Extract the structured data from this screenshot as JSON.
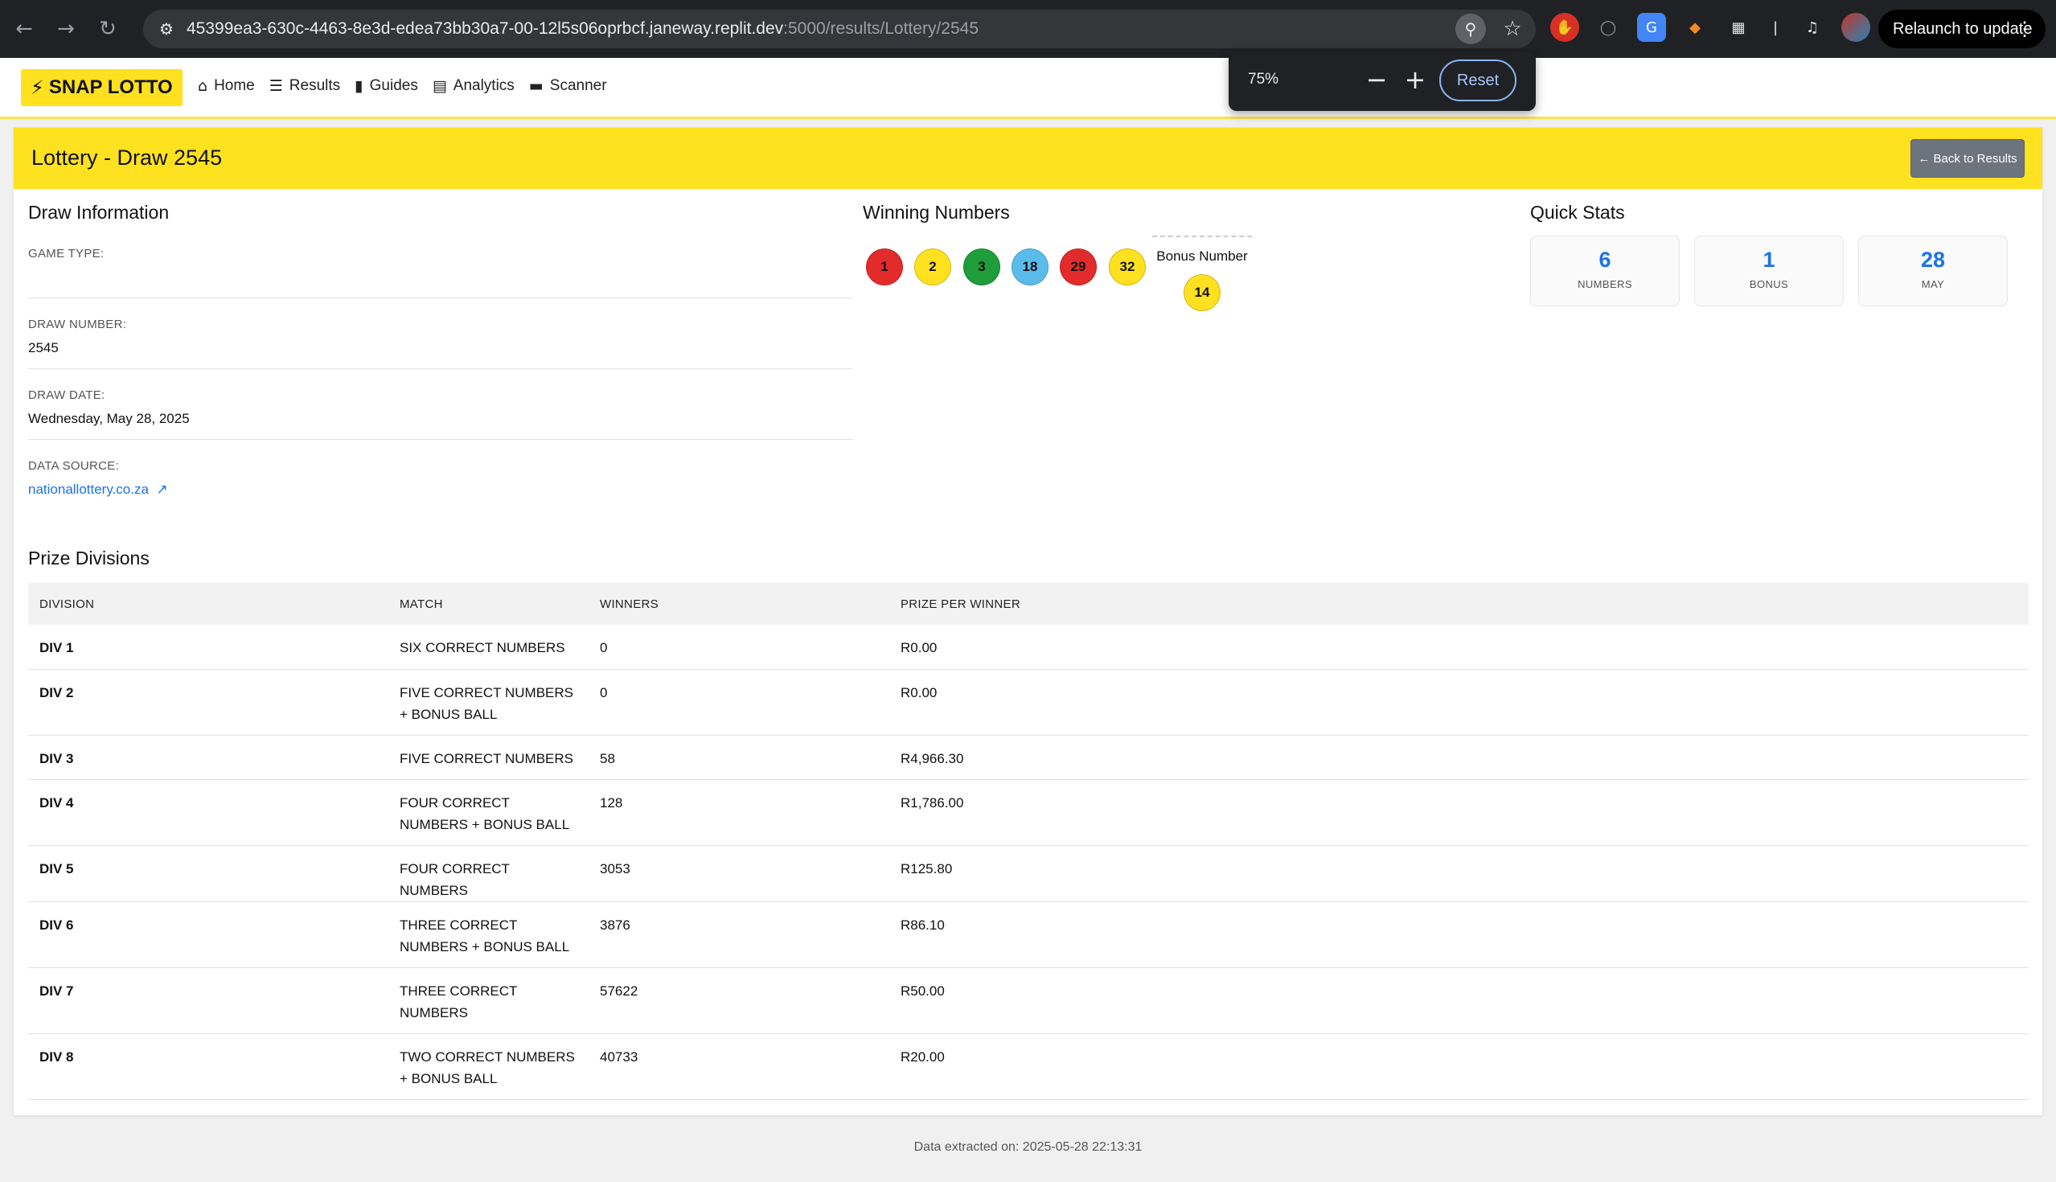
{
  "browser": {
    "url_host": "45399ea3-630c-4463-8e3d-edea73bb30a7-00-12l5s06oprbcf.janeway.replit.dev",
    "url_path": ":5000/results/Lottery/2545",
    "relaunch_label": "Relaunch to update",
    "zoom": {
      "value": "75%",
      "reset_label": "Reset"
    },
    "icons": [
      "back-arrow-icon",
      "forward-arrow-icon",
      "reload-icon",
      "site-settings-icon",
      "zoom-icon",
      "bookmark-star-icon",
      "extension-icon",
      "more-vert-icon"
    ]
  },
  "nav": {
    "brand": "SNAP LOTTO",
    "links": [
      {
        "label": "Home",
        "icon": "home-icon"
      },
      {
        "label": "Results",
        "icon": "list-icon"
      },
      {
        "label": "Guides",
        "icon": "book-icon"
      },
      {
        "label": "Analytics",
        "icon": "chart-icon"
      },
      {
        "label": "Scanner",
        "icon": "ticket-icon"
      }
    ]
  },
  "header": {
    "title": "Lottery - Draw 2545",
    "back_label": "Back to Results"
  },
  "draw_info": {
    "title": "Draw Information",
    "game_type_label": "GAME TYPE:",
    "game_type_value": "",
    "draw_number_label": "DRAW NUMBER:",
    "draw_number_value": "2545",
    "draw_date_label": "DRAW DATE:",
    "draw_date_value": "Wednesday, May 28, 2025",
    "source_label": "DATA SOURCE:",
    "source_value": "nationallottery.co.za"
  },
  "winning": {
    "title": "Winning Numbers",
    "balls": [
      {
        "n": "1",
        "color": "#e32b2b"
      },
      {
        "n": "2",
        "color": "#ffe11f"
      },
      {
        "n": "3",
        "color": "#1f9d3a"
      },
      {
        "n": "18",
        "color": "#5bbcec"
      },
      {
        "n": "29",
        "color": "#e32b2b"
      },
      {
        "n": "32",
        "color": "#ffe11f"
      }
    ],
    "bonus_label": "Bonus Number",
    "bonus": "14"
  },
  "stats": {
    "title": "Quick Stats",
    "items": [
      {
        "value": "6",
        "label": "NUMBERS"
      },
      {
        "value": "1",
        "label": "BONUS"
      },
      {
        "value": "28",
        "label": "MAY"
      }
    ]
  },
  "prizes": {
    "title": "Prize Divisions",
    "headers": [
      "DIVISION",
      "MATCH",
      "WINNERS",
      "PRIZE PER WINNER"
    ],
    "rows": [
      {
        "division": "DIV 1",
        "match": "SIX CORRECT NUMBERS",
        "winners": "0",
        "prize": "R0.00"
      },
      {
        "division": "DIV 2",
        "match": "FIVE CORRECT NUMBERS + BONUS BALL",
        "winners": "0",
        "prize": "R0.00"
      },
      {
        "division": "DIV 3",
        "match": "FIVE CORRECT NUMBERS",
        "winners": "58",
        "prize": "R4,966.30"
      },
      {
        "division": "DIV 4",
        "match": "FOUR CORRECT NUMBERS + BONUS BALL",
        "winners": "128",
        "prize": "R1,786.00"
      },
      {
        "division": "DIV 5",
        "match": "FOUR CORRECT NUMBERS",
        "winners": "3053",
        "prize": "R125.80"
      },
      {
        "division": "DIV 6",
        "match": "THREE CORRECT NUMBERS + BONUS BALL",
        "winners": "3876",
        "prize": "R86.10"
      },
      {
        "division": "DIV 7",
        "match": "THREE CORRECT NUMBERS",
        "winners": "57622",
        "prize": "R50.00"
      },
      {
        "division": "DIV 8",
        "match": "TWO CORRECT NUMBERS + BONUS BALL",
        "winners": "40733",
        "prize": "R20.00"
      }
    ]
  },
  "footer": "Data extracted on: 2025-05-28 22:13:31"
}
